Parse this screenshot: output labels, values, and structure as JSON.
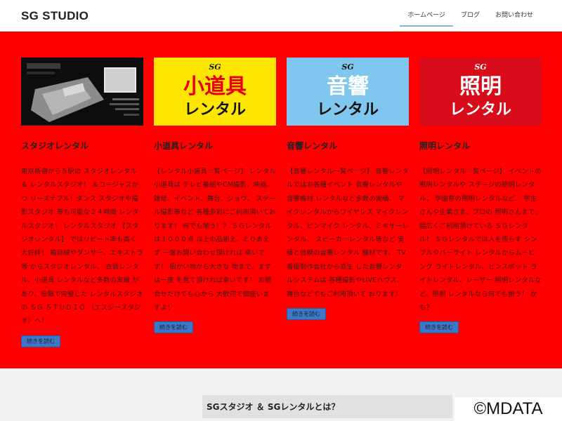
{
  "header": {
    "brand": "SG STUDIO",
    "nav": [
      {
        "label": "ホームページ",
        "active": true
      },
      {
        "label": "ブログ",
        "active": false
      },
      {
        "label": "お問い合わせ",
        "active": false
      }
    ]
  },
  "colors": {
    "band": "#ff0000",
    "button": "#3d77c9"
  },
  "cards": [
    {
      "title": "スタジオレンタル",
      "image": {
        "kind": "studio-photo",
        "big_text": "",
        "sub_text": ""
      },
      "body": "東京新宿から５駅の スタジオレンタル＆ レンタルスタジオ！ ＆コージャスかつ リーズナブル！ダンス スタジオや撮影スタジオ 等も可能な２４時間 レンタルスタジオ！ レンタルスタジオ 【スタジオレンタル】 ではリピート率も高く 大好評！ 箱目線やダンサー、エキストラ等 からスタジオレンタル、 衣装レンタル、小道具 レンタルなど多数の実績 があり、役職で完璧した レンタルスタジオの ＳＧ ＳＴＵＤＩＯ （エスジースタジオ）へ！",
      "button": "続きを読む"
    },
    {
      "title": "小道具レンタル",
      "image": {
        "kind": "yellow",
        "big_text": "小道具",
        "sub_text": "レンタル"
      },
      "body": "【レンタル小道具一覧ページ】 レンタル小道具は テレビ番組やCM撮影、映画、 雑誌、イベント、舞台、ショウ、 ステール撮影等など 各種多彩にご利用頂いております！ 何でも揃う！？ ＳＧレンタルは１０００点 以上の品揃え、とりあえず 一度お問い合わせ頂ければ 幸いです！ 細かい物から大きな 物まで、まずは一度 を見て頂ければ幸いです！ お問合せだけでも心から 大歓迎で御座いますよ！",
      "button": "続きを読む"
    },
    {
      "title": "音響レンタル",
      "image": {
        "kind": "blue",
        "big_text": "音響",
        "sub_text": "レンタル"
      },
      "body": "【音響レンタル一覧ページ】 音響レンタルではお各種イベント 音響レンタルや音響機材 レンタルなど多数の実績、 マイクレンタルからワイヤレス マイクレンタル、ピンマイク レンタル、ミキサーレンタル、 スピーカーレンタル等など 実績と信頼の音響レンタル 機材です。 TV番組制作会社から派生 した音響レンタルシステムは 各種撮影やLIVEハウス、 舞台などでもご利用頂いて おります！",
      "button": "続きを読む"
    },
    {
      "title": "照明レンタル",
      "image": {
        "kind": "darkred",
        "big_text": "照明",
        "sub_text": "レンタル"
      },
      "body": "【照明レンタル一覧ページ】 イベントの照明レンタルや ステージの照明レンタル、 学園祭の照明レンタルなど、 学生さんや企業さま、プロの 照明さんまで、幅広くご利用頂けている ＳＧレンタル！ ＳＧレンタルでは人を照らす シンプルやバーライト レンタルからムービング ライトレンタル、ピンスポット ライトレンタル、レーザー 照明レンタルなど、照明 レンタルなら何でも揃う！ かも？",
      "button": "続きを読む"
    }
  ],
  "section": {
    "title": "SGスタジオ ＆ SGレンタルとは？"
  },
  "watermark": "©MDATA"
}
